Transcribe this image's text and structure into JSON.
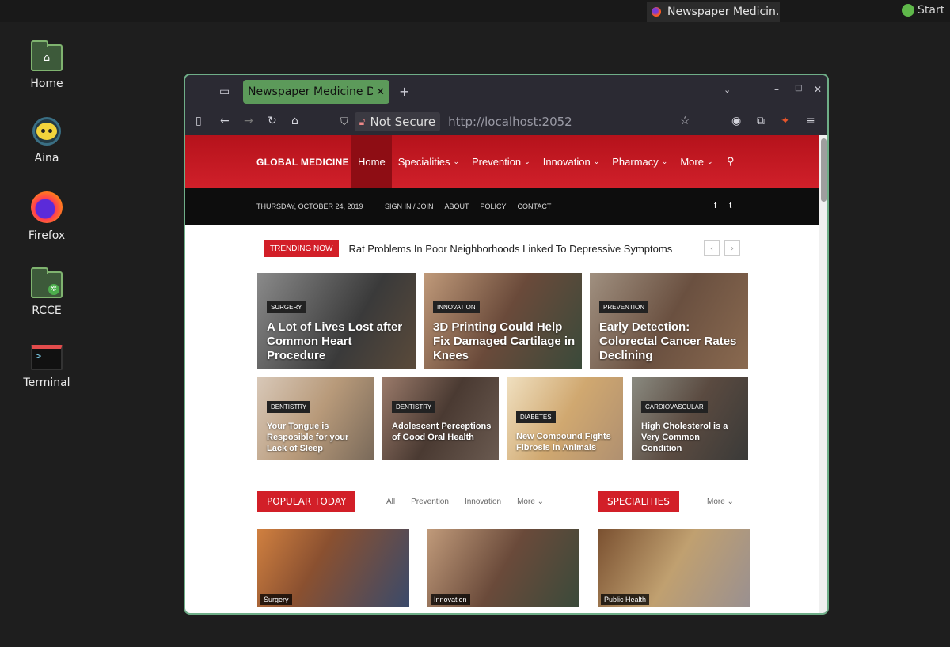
{
  "panel": {
    "task_title": "Newspaper Medicin...",
    "start_label": "Start"
  },
  "desktop": {
    "icons": [
      {
        "label": "Home"
      },
      {
        "label": "Aina"
      },
      {
        "label": "Firefox"
      },
      {
        "label": "RCCE"
      },
      {
        "label": "Terminal"
      }
    ]
  },
  "browser": {
    "tab_title": "Newspaper Medicine De",
    "security_label": "Not Secure",
    "url_host": "http://localhost",
    "url_port": ":2052"
  },
  "site": {
    "logo": "GLOBAL MEDICINE",
    "nav": [
      {
        "label": "Home",
        "caret": ""
      },
      {
        "label": "Specialities",
        "caret": "⌄"
      },
      {
        "label": "Prevention",
        "caret": "⌄"
      },
      {
        "label": "Innovation",
        "caret": "⌄"
      },
      {
        "label": "Pharmacy",
        "caret": "⌄"
      },
      {
        "label": "More",
        "caret": "⌄"
      }
    ],
    "date": "THURSDAY, OCTOBER 24, 2019",
    "top_links": [
      "SIGN IN / JOIN",
      "ABOUT",
      "POLICY",
      "CONTACT"
    ],
    "social": [
      "f",
      "t"
    ],
    "trending_label": "TRENDING NOW",
    "trending_text": "Rat Problems In Poor Neighborhoods Linked To Depressive Symptoms",
    "featured": [
      {
        "category": "SURGERY",
        "title": "A Lot of Lives Lost after Common Heart Procedure"
      },
      {
        "category": "INNOVATION",
        "title": "3D Printing Could Help Fix Damaged Cartilage in Knees"
      },
      {
        "category": "PREVENTION",
        "title": "Early Detection: Colorectal Cancer Rates Declining"
      }
    ],
    "secondary": [
      {
        "category": "DENTISTRY",
        "title": "Your Tongue is Resposible for your Lack of Sleep"
      },
      {
        "category": "DENTISTRY",
        "title": "Adolescent Perceptions of Good Oral Health"
      },
      {
        "category": "DIABETES",
        "title": "New Compound Fights Fibrosis in Animals"
      },
      {
        "category": "CARDIOVASCULAR",
        "title": "High Cholesterol is a Very Common Condition"
      }
    ],
    "popular_label": "POPULAR TODAY",
    "popular_filters": [
      "All",
      "Prevention",
      "Innovation",
      "More ⌄"
    ],
    "specialities_label": "SPECIALITIES",
    "specialities_more": "More ⌄",
    "popular_items": [
      {
        "category": "Surgery"
      },
      {
        "category": "Innovation"
      },
      {
        "category": "Public Health"
      }
    ]
  },
  "colors": {
    "brand_red": "#d21f28",
    "tab_green": "#5c9a5a",
    "window_border": "#6fae88"
  }
}
